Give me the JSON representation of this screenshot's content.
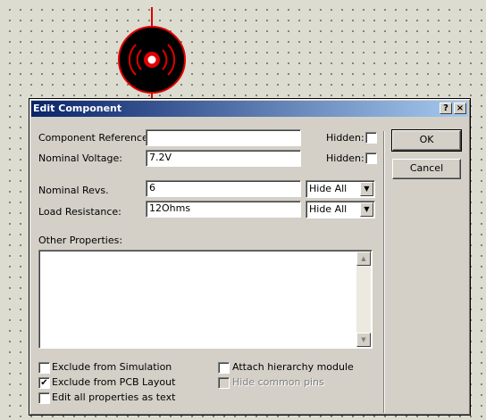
{
  "canvas": {
    "motor_symbol": "motor-symbol"
  },
  "dialog": {
    "title": "Edit Component",
    "help_label": "?",
    "close_label": "×",
    "fields": {
      "component_reference": {
        "label": "Component Reference:",
        "value": ""
      },
      "nominal_voltage": {
        "label": "Nominal Voltage:",
        "value": "7.2V"
      },
      "nominal_revs": {
        "label": "Nominal Revs.",
        "value": "6"
      },
      "load_resistance": {
        "label": "Load Resistance:",
        "value": "12Ohms"
      }
    },
    "hidden_label": "Hidden:",
    "hide_option": "Hide All",
    "other_properties_label": "Other Properties:",
    "other_properties_value": "",
    "ok_label": "OK",
    "cancel_label": "Cancel",
    "options": {
      "exclude_simulation": {
        "label": "Exclude from Simulation",
        "checked": false
      },
      "exclude_pcb": {
        "label": "Exclude from PCB Layout",
        "checked": true
      },
      "edit_all_text": {
        "label": "Edit all properties as text",
        "checked": false
      },
      "attach_hierarchy": {
        "label": "Attach hierarchy module",
        "checked": false
      },
      "hide_common_pins": {
        "label": "Hide common pins",
        "checked": false,
        "disabled": true
      }
    },
    "check_mark": "✔"
  }
}
